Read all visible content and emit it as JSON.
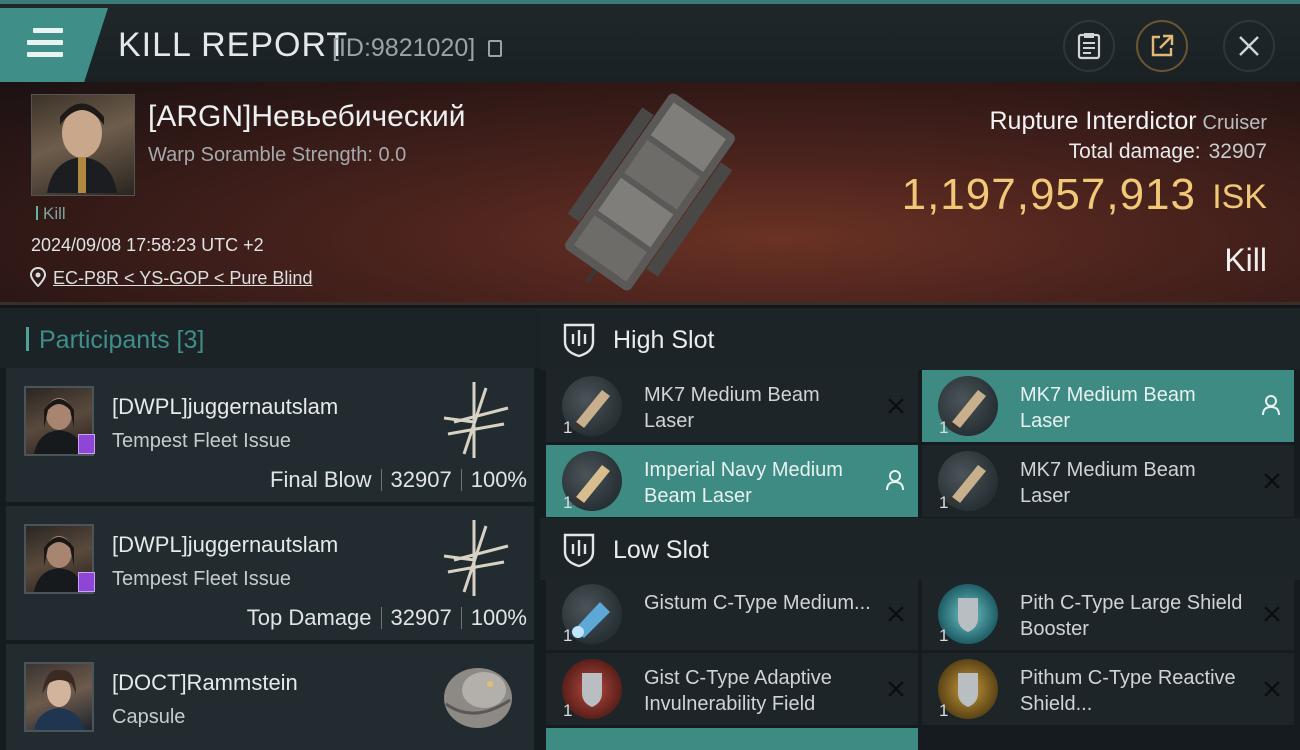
{
  "header": {
    "title": "KILL REPORT",
    "report_id": "[ID:9821020]"
  },
  "victim": {
    "name": "[ARGN]Невьебический",
    "scramble": "Warp Soramble Strength: 0.0",
    "tag": "Kill",
    "timestamp": "2024/09/08 17:58:23 UTC +2",
    "location": "EC-P8R < YS-GOP < Pure Blind",
    "ship": "Rupture Interdictor",
    "ship_class": "Cruiser",
    "total_damage_label": "Total damage:",
    "total_damage": "32907",
    "isk_value": "1,197,957,913",
    "isk_label": "ISK",
    "result": "Kill"
  },
  "participants": {
    "title": "Participants [3]",
    "items": [
      {
        "name": "[DWPL]juggernautslam",
        "ship": "Tempest Fleet Issue",
        "role": "Final Blow",
        "damage": "32907",
        "percent": "100%"
      },
      {
        "name": "[DWPL]juggernautslam",
        "ship": "Tempest Fleet Issue",
        "role": "Top Damage",
        "damage": "32907",
        "percent": "100%"
      },
      {
        "name": "[DOCT]Rammstein",
        "ship": "Capsule"
      }
    ]
  },
  "high_slot": {
    "label": "High Slot",
    "modules": [
      {
        "name": "MK7 Medium Beam Laser",
        "qty": "1",
        "status": "destroyed"
      },
      {
        "name": "MK7 Medium Beam Laser",
        "qty": "1",
        "status": "dropped"
      },
      {
        "name": "Imperial Navy Medium Beam Laser",
        "qty": "1",
        "status": "dropped"
      },
      {
        "name": "MK7 Medium Beam Laser",
        "qty": "1",
        "status": "destroyed"
      }
    ]
  },
  "low_slot": {
    "label": "Low Slot",
    "modules": [
      {
        "name": "Gistum C-Type Medium...",
        "qty": "1",
        "status": "destroyed"
      },
      {
        "name": "Pith C-Type Large Shield Booster",
        "qty": "1",
        "status": "destroyed"
      },
      {
        "name": "Gist C-Type Adaptive Invulnerability Field",
        "qty": "1",
        "status": "destroyed"
      },
      {
        "name": "Pithum C-Type Reactive Shield...",
        "qty": "1",
        "status": "destroyed"
      }
    ]
  },
  "colors": {
    "accent": "#3f8e87",
    "isk": "#f0c878",
    "active_module": "#3e8b84"
  }
}
